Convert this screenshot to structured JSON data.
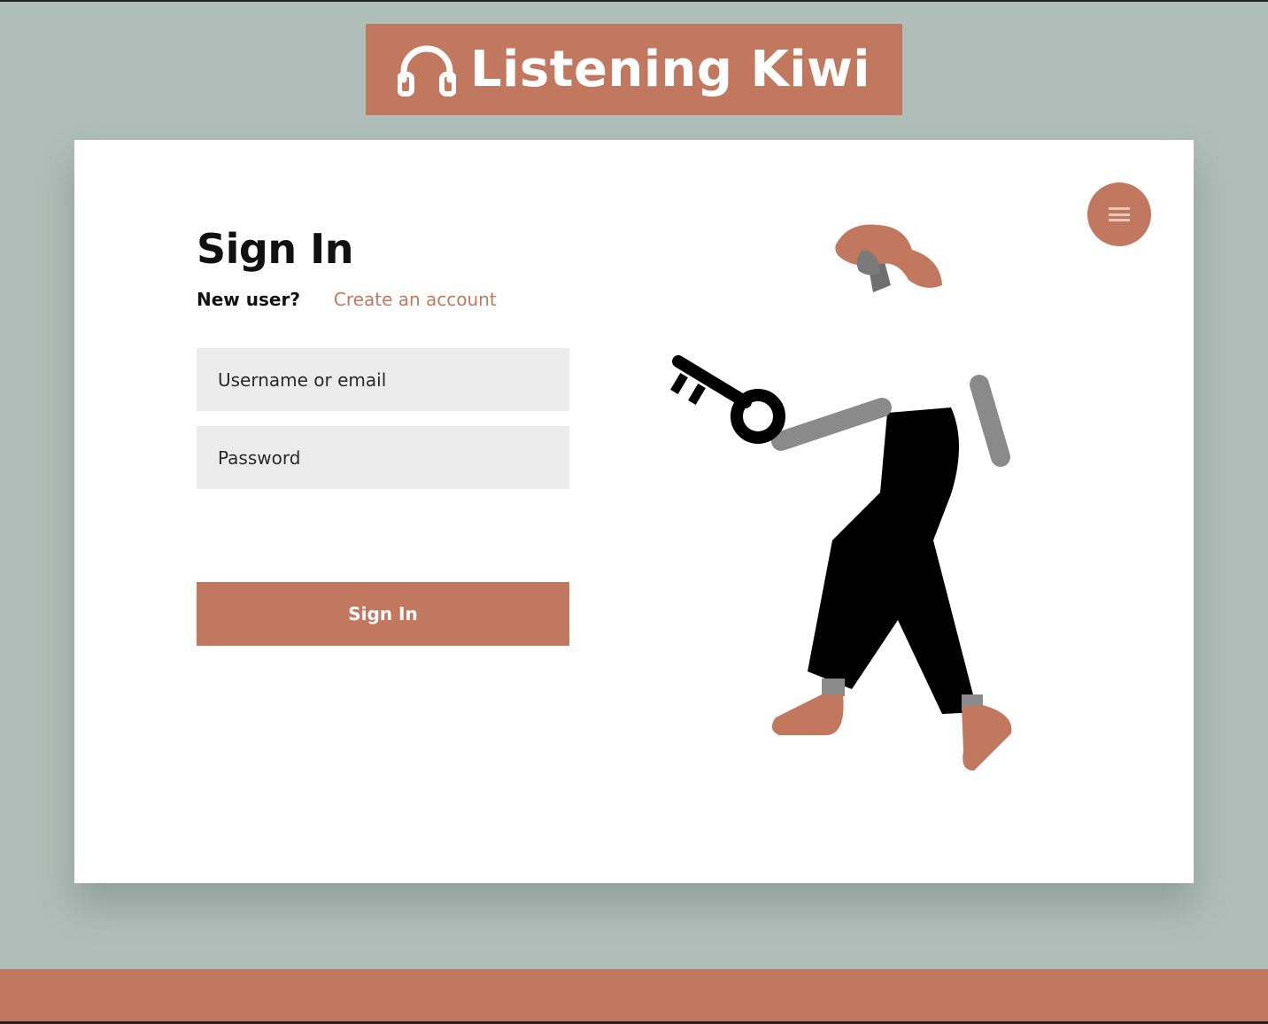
{
  "brand": {
    "name": "Listening Kiwi",
    "icon": "headphones-icon"
  },
  "signin": {
    "title": "Sign In",
    "new_user_label": "New user?",
    "create_account_link": "Create an account",
    "username_placeholder": "Username or email",
    "password_placeholder": "Password",
    "submit_label": "Sign In"
  },
  "menu": {
    "icon": "menu-icon"
  },
  "illustration": {
    "subject": "person-holding-key-illustration"
  },
  "colors": {
    "background": "#afbeb8",
    "accent": "#c1785f",
    "card": "#ffffff",
    "input_background": "#ececec",
    "text": "#111111"
  }
}
